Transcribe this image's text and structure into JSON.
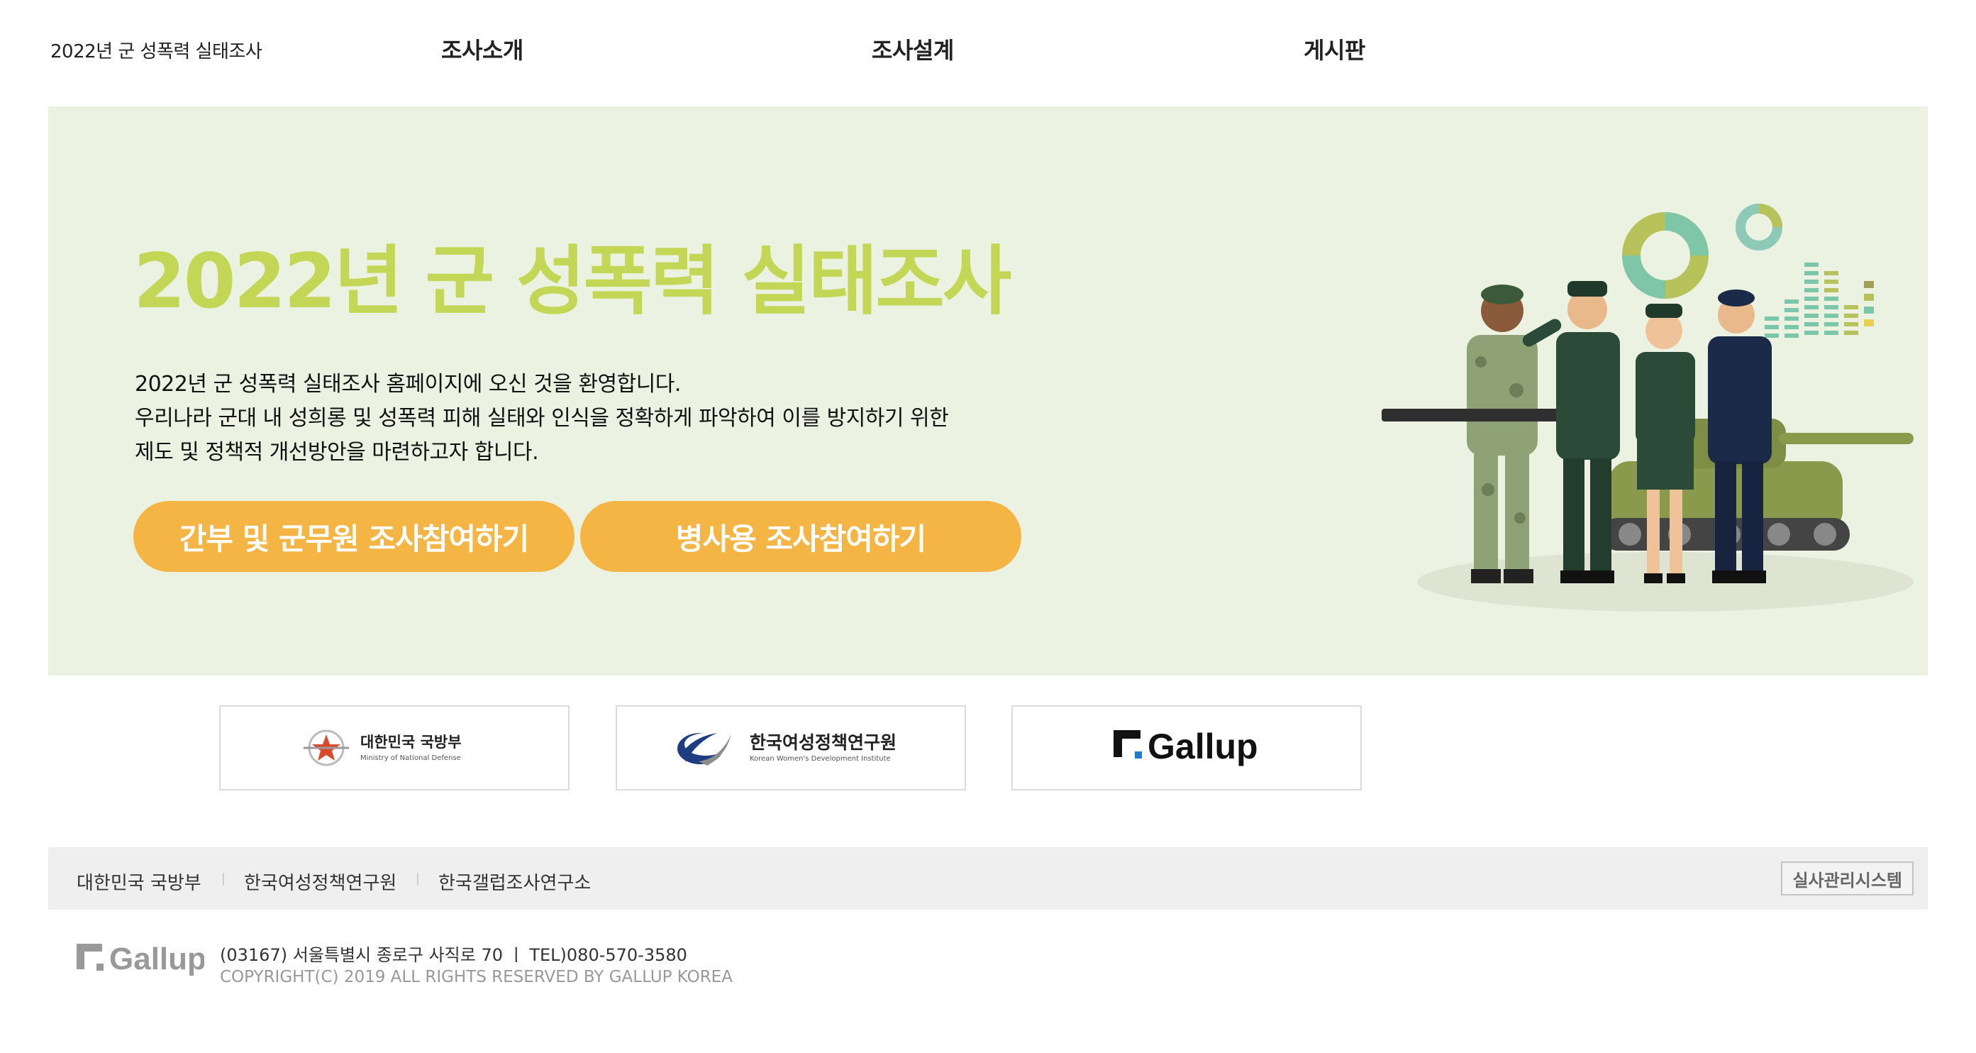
{
  "header": {
    "site_title": "2022년 군 성폭력 실태조사",
    "nav": [
      {
        "label": "조사소개"
      },
      {
        "label": "조사설계"
      },
      {
        "label": "게시판"
      }
    ]
  },
  "hero": {
    "title": "2022년 군 성폭력 실태조사",
    "description": [
      "2022년 군 성폭력 실태조사 홈페이지에 오신 것을 환영합니다.",
      "우리나라 군대 내 성희롱 및 성폭력 피해 실태와 인식을 정확하게 파악하여 이를 방지하기 위한",
      "제도 및 정책적 개선방안을 마련하고자 합니다."
    ],
    "buttons": [
      {
        "label": "간부 및 군무원 조사참여하기"
      },
      {
        "label": "병사용 조사참여하기"
      }
    ],
    "illustration_icon": "saluting-soldiers-and-tank-illustration"
  },
  "logos": [
    {
      "name_ko": "대한민국 국방부",
      "name_en": "Ministry of National Defense",
      "icon": "mnd-emblem-icon"
    },
    {
      "name_ko": "한국여성정책연구원",
      "name_en": "Korean Women's Development Institute",
      "icon": "kwdi-logo-icon"
    },
    {
      "name": "Gallup",
      "icon": "gallup-logo-icon"
    }
  ],
  "footer": {
    "links": [
      {
        "label": "대한민국 국방부"
      },
      {
        "label": "한국여성정책연구원"
      },
      {
        "label": "한국갤럽조사연구소"
      }
    ],
    "admin_button": "실사관리시스템",
    "logo_text": "Gallup",
    "address": "(03167) 서울특별시 종로구 사직로 70  ㅣ  TEL)080-570-3580",
    "copyright": "COPYRIGHT(C) 2019 ALL RIGHTS RESERVED BY GALLUP KOREA"
  },
  "colors": {
    "hero_bg": "#ecf2e2",
    "title_green": "#c3d656",
    "button_orange": "#f4b545",
    "footer_bar": "#efefef"
  }
}
